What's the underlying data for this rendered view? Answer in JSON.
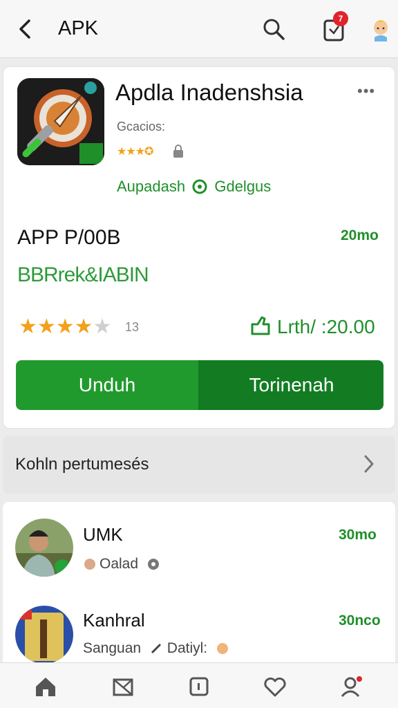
{
  "header": {
    "title": "APK",
    "notification_count": "7"
  },
  "app": {
    "name": "Apdla Inadenshsia",
    "developer": "Gcacios:",
    "mini_rating_stars": "★★★✪",
    "tagline_left": "Aupadash",
    "tagline_right": "Gdelgus",
    "size_label": "APP P/00B",
    "size_value": "20mo",
    "version": "BBRrek&IABIN",
    "rating_stars_filled": "★★★★",
    "rating_stars_empty": "★",
    "rating_count": "13",
    "share_text": "Lrth/ :20.00",
    "download_label": "Unduh",
    "secondary_label": "Torinenah"
  },
  "section": {
    "label": "Kohln pertumesés"
  },
  "list": [
    {
      "name": "UMK",
      "value": "30mo",
      "sub": "Oalad"
    },
    {
      "name": "Kanhral",
      "value": "30nco",
      "sub_left": "Sanguan",
      "sub_right": "Datiyl:"
    }
  ],
  "colors": {
    "accent_green": "#219a2d",
    "dark_green": "#137c23",
    "star": "#f2a11a",
    "badge": "#e0242c"
  },
  "icons": [
    "back-arrow-icon",
    "search-icon",
    "notification-icon",
    "user-avatar-icon",
    "more-icon",
    "lock-icon",
    "share-icon",
    "chevron-right-icon",
    "home-icon",
    "mail-icon",
    "square-icon",
    "heart-icon",
    "profile-icon"
  ]
}
